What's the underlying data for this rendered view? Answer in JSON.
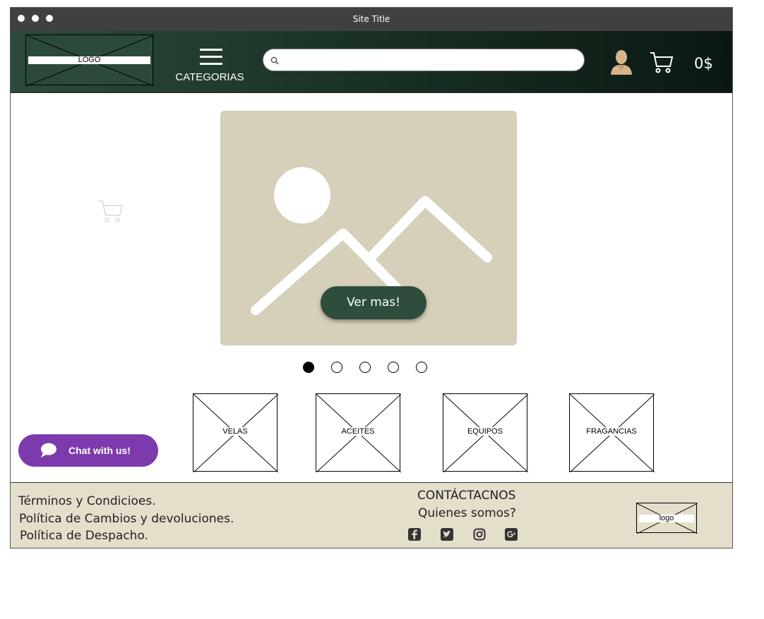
{
  "window": {
    "title": "Site Title"
  },
  "header": {
    "logo_text": "LOGO",
    "menu_label": "CATEGORIAS",
    "search_placeholder": "",
    "cart_total": "0$",
    "icons": [
      "hamburger-icon",
      "search-icon",
      "user-icon",
      "cart-icon"
    ]
  },
  "hero": {
    "button_label": "Ver mas!",
    "slides": 5,
    "active_slide": 1,
    "image_placeholder": "image-placeholder-icon"
  },
  "categories": [
    {
      "label": "VELAS"
    },
    {
      "label": "ACEITES"
    },
    {
      "label": "EQUIPOS"
    },
    {
      "label": "FRAGANCIAS"
    }
  ],
  "chat": {
    "label": "Chat with us!"
  },
  "footer": {
    "links_left": [
      "Términos y Condicioes.",
      "Política de Cambios y devoluciones.",
      "Política de Despacho."
    ],
    "contact_label": "CONTÁCTACNOS",
    "about_label": "Quienes somos?",
    "social_icons": [
      "facebook-icon",
      "twitter-icon",
      "instagram-icon",
      "google-plus-icon"
    ],
    "logo_text": "logo"
  },
  "colors": {
    "header_dark": "#0b1812",
    "header_green": "#2c4a3a",
    "hero_bg": "#d6cfb9",
    "button_green": "#2e4d3d",
    "chat_purple": "#7c3aad",
    "footer_bg": "#e5decb"
  }
}
